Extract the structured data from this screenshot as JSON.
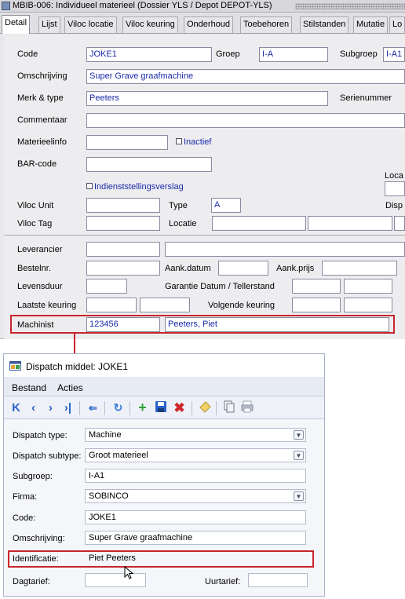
{
  "win1": {
    "title": "MBIB-006: Individueel materieel (Dossier YLS / Depot DEPOT-YLS)",
    "tabs": [
      "Detail",
      "Lijst",
      "Viloc locatie",
      "Viloc keuring",
      "Onderhoud",
      "Toebehoren",
      "Stilstanden",
      "Mutatie",
      "Lo"
    ],
    "active_tab": "Detail",
    "labels": {
      "code": "Code",
      "groep": "Groep",
      "subgroep": "Subgroep",
      "omschrijving": "Omschrijving",
      "merk": "Merk & type",
      "serienummer": "Serienummer",
      "commentaar": "Commentaar",
      "materieelinfo": "Materieelinfo",
      "inactief": "Inactief",
      "barcode": "BAR-code",
      "loca": "Loca",
      "indienst": "Indienststellingsverslag",
      "viloc_unit": "Viloc Unit",
      "type": "Type",
      "disp": "Disp",
      "viloc_tag": "Viloc Tag",
      "locatie": "Locatie",
      "leverancier": "Leverancier",
      "bestelnr": "Bestelnr.",
      "aank_datum": "Aank.datum",
      "aank_prijs": "Aank.prijs",
      "levensduur": "Levensduur",
      "garantie": "Garantie Datum / Tellerstand",
      "laatste_keuring": "Laatste keuring",
      "volgende_keuring": "Volgende keuring",
      "machinist": "Machinist"
    },
    "values": {
      "code": "JOKE1",
      "groep": "I-A",
      "subgroep": "I-A1",
      "omschrijving": "Super Grave graafmachine",
      "merk": "Peeters",
      "type": "A",
      "machinist_code": "123456",
      "machinist_name": "Peeters, Piet"
    }
  },
  "win2": {
    "title": "Dispatch middel: JOKE1",
    "menu": [
      "Bestand",
      "Acties"
    ],
    "toolbar_icons": [
      "first-icon",
      "previous-icon",
      "next-icon",
      "last-icon",
      "back-icon",
      "refresh-icon",
      "add-icon",
      "save-icon",
      "delete-icon",
      "clear-icon",
      "copy-icon",
      "print-icon"
    ],
    "fields": [
      {
        "label": "Dispatch type:",
        "value": "Machine"
      },
      {
        "label": "Dispatch subtype:",
        "value": "Groot materieel"
      },
      {
        "label": "Subgroep:",
        "value": "I-A1"
      },
      {
        "label": "Firma:",
        "value": "SOBINCO"
      },
      {
        "label": "Code:",
        "value": "JOKE1"
      },
      {
        "label": "Omschrijving:",
        "value": "Super Grave graafmachine"
      },
      {
        "label": "Identificatie:",
        "value": "Piet Peeters"
      }
    ],
    "dagtarief_label": "Dagtarief:",
    "uurtarief_label": "Uurtarief:"
  },
  "colors": {
    "highlight": "#c8262c",
    "field_text": "#1a2aa8"
  }
}
